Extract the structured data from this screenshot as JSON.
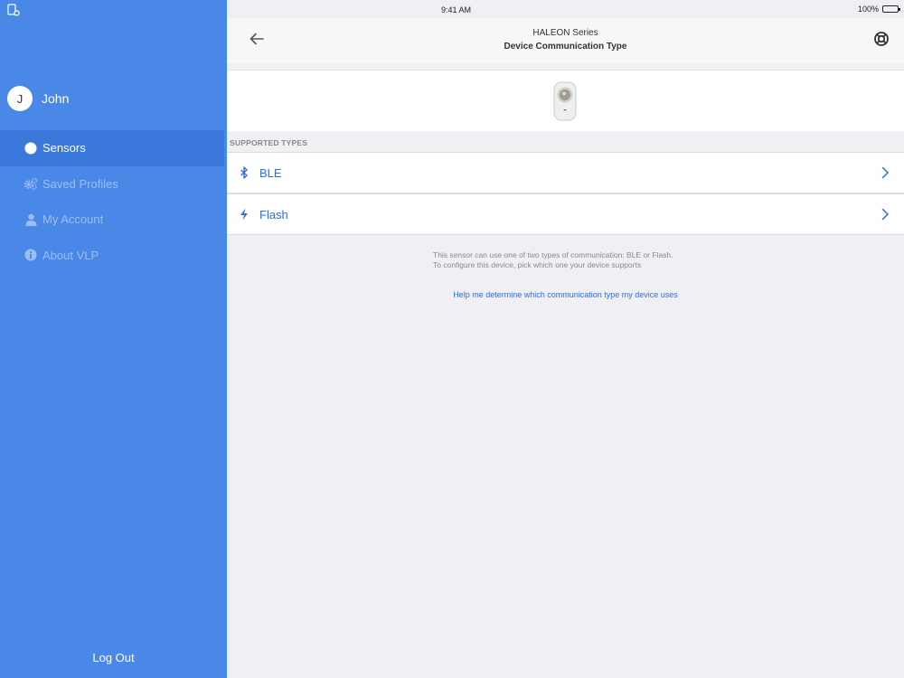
{
  "status_bar": {
    "time": "9:41 AM",
    "battery": "100%"
  },
  "sidebar": {
    "user": {
      "initial": "J",
      "name": "John"
    },
    "items": [
      {
        "label": "Sensors",
        "icon": "circle-icon",
        "active": true
      },
      {
        "label": "Saved Profiles",
        "icon": "gears-icon",
        "active": false
      },
      {
        "label": "My Account",
        "icon": "user-icon",
        "active": false
      },
      {
        "label": "About VLP",
        "icon": "info-icon",
        "active": false
      }
    ],
    "logout_label": "Log Out"
  },
  "header": {
    "subtitle": "HALEON Series",
    "title": "Device Communication Type"
  },
  "section_label": "SUPPORTED TYPES",
  "types": [
    {
      "label": "BLE",
      "icon": "bluetooth-icon"
    },
    {
      "label": "Flash",
      "icon": "lightning-icon"
    }
  ],
  "note": {
    "line1": "This sensor can use one of two types of communication: BLE or Flash.",
    "line2": "To configure this device, pick which one your device supports"
  },
  "help_link": "Help me determine which communication type my device uses",
  "colors": {
    "sidebar": "#4a88e8",
    "accent": "#2f6fd6",
    "background": "#efeff4"
  }
}
